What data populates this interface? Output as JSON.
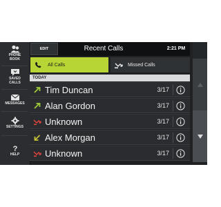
{
  "sidebar": {
    "items": [
      {
        "label": "PHONE\nBOOK",
        "icon": "phonebook-icon"
      },
      {
        "label": "SAVED\nCALLS",
        "icon": "saved-calls-icon"
      },
      {
        "label": "MESSAGES",
        "icon": "messages-icon"
      },
      {
        "label": "SETTINGS",
        "icon": "gear-icon"
      },
      {
        "label": "HELP",
        "icon": "question-icon"
      }
    ]
  },
  "header": {
    "edit_label": "EDIT",
    "title": "Recent Calls",
    "time": "2:21 PM"
  },
  "tabs": {
    "all_calls": "All Calls",
    "missed_calls": "Missed Calls",
    "active": "All Calls"
  },
  "section_header": "TODAY",
  "calls": [
    {
      "name": "Tim Duncan",
      "date": "3/17",
      "type": "outgoing"
    },
    {
      "name": "Alan Gordon",
      "date": "3/17",
      "type": "outgoing"
    },
    {
      "name": "Unknown",
      "date": "3/17",
      "type": "missed"
    },
    {
      "name": "Alex Morgan",
      "date": "3/17",
      "type": "incoming"
    },
    {
      "name": "Unknown",
      "date": "3/17",
      "type": "missed"
    }
  ],
  "colors": {
    "accent": "#b7d534",
    "missed": "#e0443c",
    "incoming": "#c6c23a",
    "outgoing": "#9fc83a"
  }
}
